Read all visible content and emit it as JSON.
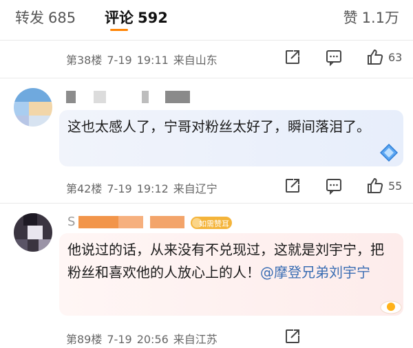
{
  "tabs": {
    "repost": {
      "label": "转发",
      "count": "685"
    },
    "comments": {
      "label": "评论",
      "count": "592"
    },
    "likes": {
      "label": "赞",
      "count": "1.1万"
    }
  },
  "comments": [
    {
      "floor": "第38楼",
      "date": "7-19",
      "time": "19:11",
      "location": "来自山东",
      "like_count": "63"
    },
    {
      "text": "这也太感人了，宁哥对粉丝太好了，瞬间落泪了。",
      "floor": "第42楼",
      "date": "7-19",
      "time": "19:12",
      "location": "来自辽宁",
      "like_count": "55"
    },
    {
      "username_initial": "S",
      "badge": "如需赞耳",
      "text": "他说过的话，从来没有不兑现过，这就是刘宇宁，把粉丝和喜欢他的人放心上的人！",
      "mention": "@摩登兄弟刘宇宁",
      "floor": "第89楼",
      "date": "7-19",
      "time": "20:56",
      "location": "来自江苏"
    }
  ],
  "icons": {
    "share": "share-icon",
    "comment": "comment-icon",
    "like": "thumbs-up-icon",
    "bubble_decoration_1": "diamond-icon",
    "bubble_decoration_2": "egg-icon",
    "badge_icon": "badge-icon"
  },
  "colors": {
    "accent": "#ff8200",
    "mention": "#3a6db3",
    "bubble_blue": "#e7eefb",
    "bubble_pink": "#fdeceb",
    "badge": "#f4b43a"
  }
}
